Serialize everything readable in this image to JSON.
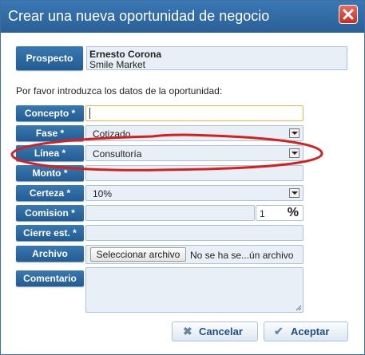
{
  "window": {
    "title": "Crear una nueva oportunidad de negocio"
  },
  "prospect": {
    "label": "Prospecto",
    "name": "Ernesto Corona",
    "company": "Smile Market"
  },
  "intro": "Por favor introduzca los datos de la oportunidad:",
  "fields": {
    "concepto": {
      "label": "Concepto *",
      "value": ""
    },
    "fase": {
      "label": "Fase *",
      "value": "Cotizado"
    },
    "linea": {
      "label": "Línea *",
      "value": "Consultoría"
    },
    "monto": {
      "label": "Monto *",
      "value": ""
    },
    "certeza": {
      "label": "Certeza *",
      "value": "10%"
    },
    "comision": {
      "label": "Comision *",
      "value": "",
      "spin_value": "1",
      "unit": "%"
    },
    "cierre": {
      "label": "Cierre est. *",
      "value": ""
    },
    "archivo": {
      "label": "Archivo",
      "button": "Seleccionar archivo",
      "status": "No se ha se...ún archivo"
    },
    "comentario": {
      "label": "Comentario",
      "value": ""
    }
  },
  "buttons": {
    "cancel": "Cancelar",
    "accept": "Aceptar"
  },
  "colors": {
    "title_bar": "#2f6aa3",
    "label_bg": "#2a65a0",
    "annotation": "#d62020"
  }
}
